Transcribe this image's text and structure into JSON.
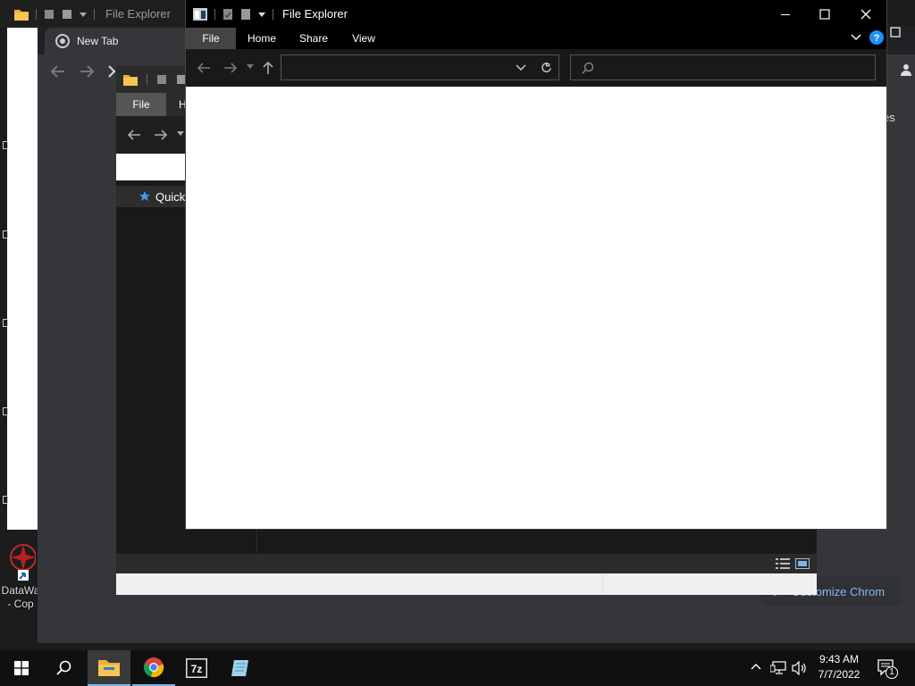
{
  "background_explorer": {
    "title": "File Explorer"
  },
  "chrome": {
    "tab_title": "New Tab",
    "ntp_text_fragment": "es",
    "customize_label": "Customize Chrom"
  },
  "middle_explorer": {
    "ribbon_file": "File",
    "ribbon_home_fragment": "H",
    "quick_access_fragment": "Quick"
  },
  "front_explorer": {
    "title": "File Explorer",
    "ribbon_tabs": [
      "File",
      "Home",
      "Share",
      "View"
    ],
    "address_value": "",
    "search_placeholder": ""
  },
  "desktop": {
    "icon_label_line1": "DataWa",
    "icon_label_line2": "- Cop"
  },
  "taskbar": {
    "time": "9:43 AM",
    "date": "7/7/2022",
    "notification_count": "1",
    "pinned": [
      "windows-start",
      "search",
      "file-explorer",
      "chrome",
      "7zip",
      "notepad-app"
    ]
  },
  "colors": {
    "accent_blue": "#1e90ff",
    "chrome_link": "#8ab4f8"
  }
}
